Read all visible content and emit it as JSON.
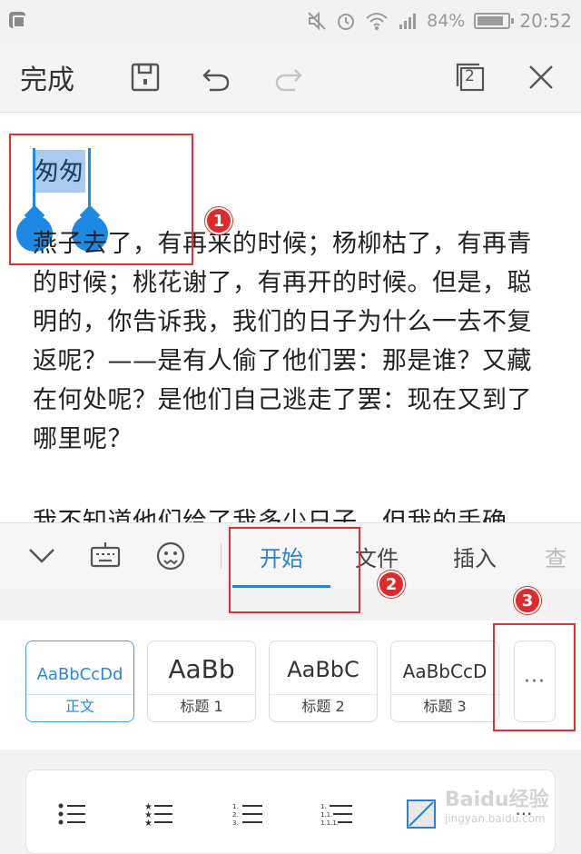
{
  "status_bar": {
    "battery_percent": "84%",
    "time": "20:52",
    "icons": [
      "app-screenshot-icon",
      "mute-icon",
      "alarm-icon",
      "wifi-icon",
      "signal-icon",
      "battery-icon"
    ]
  },
  "toolbar": {
    "done_label": "完成",
    "page_count": "2",
    "icons": [
      "save-icon",
      "undo-icon",
      "redo-icon",
      "pages-icon",
      "close-icon"
    ]
  },
  "document": {
    "selected_text": "匆匆",
    "paragraph1": "燕子去了，有再来的时候；杨柳枯了，有再青的时候；桃花谢了，有再开的时候。但是，聪明的，你告诉我，我们的日子为什么一去不复返呢？——是有人偷了他们罢：那是谁？又藏在何处呢？是他们自己逃走了罢：现在又到了哪里呢？",
    "paragraph2": "我不知道他们给了我多少日子，但我的手确"
  },
  "annotations": {
    "badge1": "1",
    "badge2": "2",
    "badge3": "3"
  },
  "tabbar": {
    "tabs": [
      {
        "label": "开始",
        "active": true
      },
      {
        "label": "文件",
        "active": false
      },
      {
        "label": "插入",
        "active": false
      },
      {
        "label": "查",
        "active": false
      }
    ],
    "icons": [
      "collapse-chevron-icon",
      "keyboard-icon",
      "emoji-icon"
    ]
  },
  "styles": {
    "items": [
      {
        "sample": "AaBbCcDd",
        "label": "正文",
        "active": true
      },
      {
        "sample": "AaBb",
        "label": "标题 1",
        "active": false
      },
      {
        "sample": "AaBbC",
        "label": "标题 2",
        "active": false
      },
      {
        "sample": "AaBbCcD",
        "label": "标题 3",
        "active": false
      }
    ],
    "more_label": "···"
  },
  "list_tools": {
    "icons": [
      "bullet-list-icon",
      "star-bullet-list-icon",
      "numbered-list-icon",
      "multilevel-list-icon",
      "no-list-icon"
    ]
  },
  "watermark": {
    "brand": "Baidu经验",
    "url": "jingyan.baidu.com"
  },
  "colors": {
    "accent": "#2a7fd4",
    "selection": "#aacbf0",
    "handle": "#1e88e5",
    "annotation": "#e03030"
  }
}
